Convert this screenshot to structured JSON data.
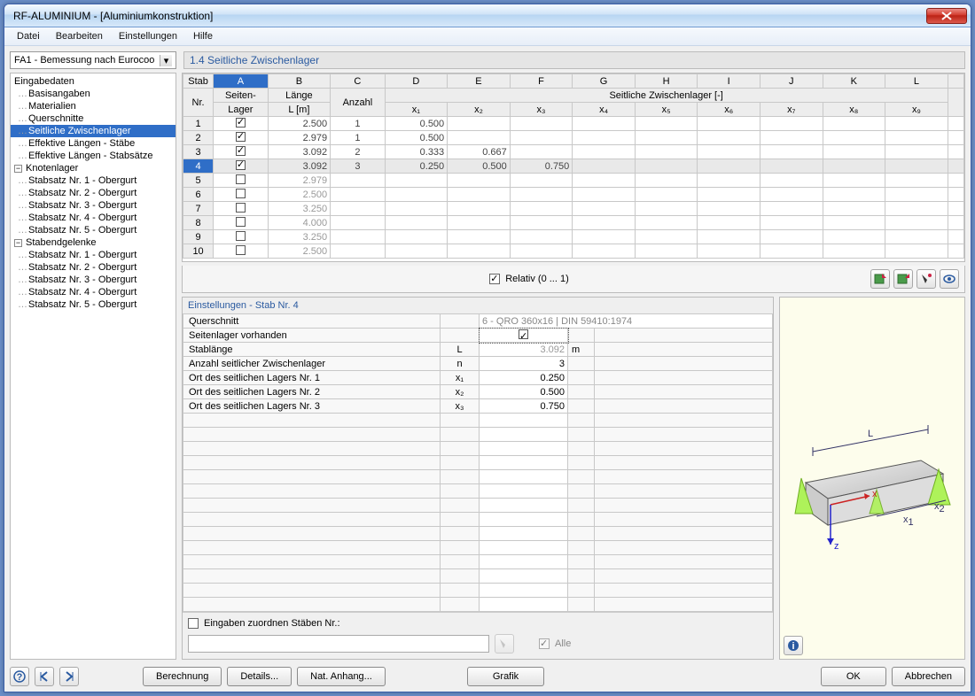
{
  "window": {
    "title": "RF-ALUMINIUM - [Aluminiumkonstruktion]"
  },
  "menu": {
    "datei": "Datei",
    "bearbeiten": "Bearbeiten",
    "einstellungen": "Einstellungen",
    "hilfe": "Hilfe"
  },
  "combo": "FA1 - Bemessung nach Eurocoo",
  "panel_title": "1.4 Seitliche Zwischenlager",
  "tree": {
    "root": "Eingabedaten",
    "items": [
      "Basisangaben",
      "Materialien",
      "Querschnitte",
      "Seitliche Zwischenlager",
      "Effektive Längen - Stäbe",
      "Effektive Längen - Stabsätze"
    ],
    "knoten": "Knotenlager",
    "knoten_items": [
      "Stabsatz Nr. 1 - Obergurt",
      "Stabsatz Nr. 2 - Obergurt",
      "Stabsatz Nr. 3 - Obergurt",
      "Stabsatz Nr. 4 - Obergurt",
      "Stabsatz Nr. 5 - Obergurt"
    ],
    "stabend": "Stabendgelenke",
    "stabend_items": [
      "Stabsatz Nr. 1 - Obergurt",
      "Stabsatz Nr. 2 - Obergurt",
      "Stabsatz Nr. 3 - Obergurt",
      "Stabsatz Nr. 4 - Obergurt",
      "Stabsatz Nr. 5 - Obergurt"
    ]
  },
  "table": {
    "cols": {
      "stab": "Stab",
      "nr": "Nr.",
      "seiten": "Seiten-",
      "lager": "Lager",
      "laenge": "Länge",
      "lm": "L [m]",
      "anzahl": "Anzahl",
      "seit_zw": "Seitliche Zwischenlager [-]"
    },
    "letters": [
      "A",
      "B",
      "C",
      "D",
      "E",
      "F",
      "G",
      "H",
      "I",
      "J",
      "K",
      "L"
    ],
    "x": [
      "x₁",
      "x₂",
      "x₃",
      "x₄",
      "x₅",
      "x₆",
      "x₇",
      "x₈",
      "x₉"
    ],
    "rows": [
      {
        "nr": "1",
        "cb": true,
        "len": "2.500",
        "anz": "1",
        "x": [
          "0.500"
        ]
      },
      {
        "nr": "2",
        "cb": true,
        "len": "2.979",
        "anz": "1",
        "x": [
          "0.500"
        ]
      },
      {
        "nr": "3",
        "cb": true,
        "len": "3.092",
        "anz": "2",
        "x": [
          "0.333",
          "0.667"
        ]
      },
      {
        "nr": "4",
        "cb": true,
        "len": "3.092",
        "anz": "3",
        "x": [
          "0.250",
          "0.500",
          "0.750"
        ],
        "sel": true
      },
      {
        "nr": "5",
        "cb": false,
        "len": "2.979"
      },
      {
        "nr": "6",
        "cb": false,
        "len": "2.500"
      },
      {
        "nr": "7",
        "cb": false,
        "len": "3.250"
      },
      {
        "nr": "8",
        "cb": false,
        "len": "4.000"
      },
      {
        "nr": "9",
        "cb": false,
        "len": "3.250"
      },
      {
        "nr": "10",
        "cb": false,
        "len": "2.500"
      }
    ]
  },
  "relativ": "Relativ (0 ... 1)",
  "details": {
    "title": "Einstellungen - Stab Nr. 4",
    "rows": [
      {
        "lbl": "Querschnitt",
        "sym": "",
        "val": "6 - QRO 360x16 | DIN 59410:1974",
        "unit": "",
        "wide": true
      },
      {
        "lbl": "Seitenlager vorhanden",
        "sym": "",
        "val": "__check__",
        "unit": ""
      },
      {
        "lbl": "Stablänge",
        "sym": "L",
        "val": "3.092",
        "unit": "m",
        "dim": true
      },
      {
        "lbl": "Anzahl seitlicher Zwischenlager",
        "sym": "n",
        "val": "3",
        "unit": ""
      },
      {
        "lbl": "Ort des seitlichen Lagers Nr. 1",
        "sym": "x₁",
        "val": "0.250",
        "unit": ""
      },
      {
        "lbl": "Ort des seitlichen Lagers Nr. 2",
        "sym": "x₂",
        "val": "0.500",
        "unit": ""
      },
      {
        "lbl": "Ort des seitlichen Lagers Nr. 3",
        "sym": "x₃",
        "val": "0.750",
        "unit": ""
      }
    ]
  },
  "assign": {
    "chk_label": "Eingaben zuordnen Stäben Nr.:",
    "alle": "Alle"
  },
  "footer": {
    "berechnung": "Berechnung",
    "details": "Details...",
    "nat": "Nat. Anhang...",
    "grafik": "Grafik",
    "ok": "OK",
    "abbrechen": "Abbrechen"
  }
}
